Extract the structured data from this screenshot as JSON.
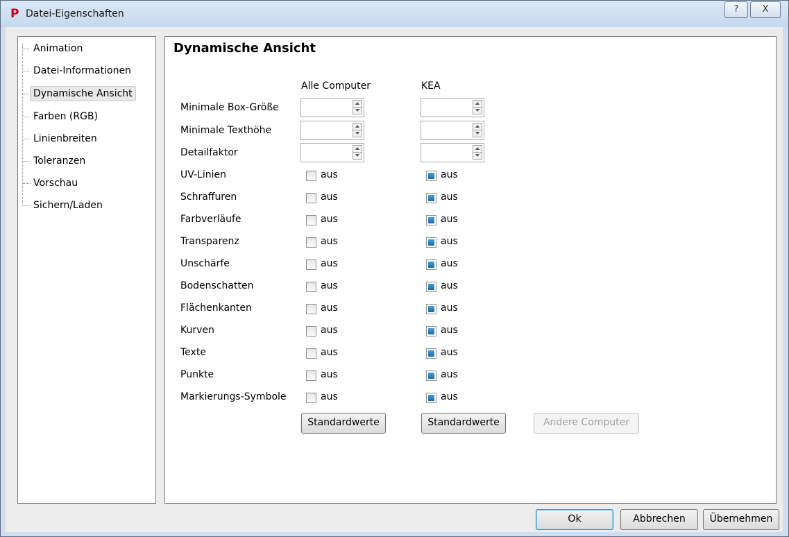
{
  "window": {
    "title": "Datei-Eigenschaften",
    "logo": "P",
    "help": "?",
    "close": "X"
  },
  "tree": {
    "items": [
      {
        "label": "Animation"
      },
      {
        "label": "Datei-Informationen"
      },
      {
        "label": "Dynamische Ansicht",
        "selected": true
      },
      {
        "label": "Farben (RGB)"
      },
      {
        "label": "Linienbreiten"
      },
      {
        "label": "Toleranzen"
      },
      {
        "label": "Vorschau"
      },
      {
        "label": "Sichern/Laden"
      }
    ]
  },
  "panel": {
    "title": "Dynamische Ansicht",
    "col_all": "Alle Computer",
    "col_kea": "KEA",
    "spin_rows": [
      {
        "label": "Minimale Box-Größe",
        "all_value": "",
        "kea_value": ""
      },
      {
        "label": "Minimale Texthöhe",
        "all_value": "",
        "kea_value": ""
      },
      {
        "label": "Detailfaktor",
        "all_value": "",
        "kea_value": ""
      }
    ],
    "check_rows": [
      {
        "label": "UV-Linien",
        "all_text": "aus",
        "kea_text": "aus"
      },
      {
        "label": "Schraffuren",
        "all_text": "aus",
        "kea_text": "aus"
      },
      {
        "label": "Farbverläufe",
        "all_text": "aus",
        "kea_text": "aus"
      },
      {
        "label": "Transparenz",
        "all_text": "aus",
        "kea_text": "aus"
      },
      {
        "label": "Unschärfe",
        "all_text": "aus",
        "kea_text": "aus"
      },
      {
        "label": "Bodenschatten",
        "all_text": "aus",
        "kea_text": "aus"
      },
      {
        "label": "Flächenkanten",
        "all_text": "aus",
        "kea_text": "aus"
      },
      {
        "label": "Kurven",
        "all_text": "aus",
        "kea_text": "aus"
      },
      {
        "label": "Texte",
        "all_text": "aus",
        "kea_text": "aus"
      },
      {
        "label": "Punkte",
        "all_text": "aus",
        "kea_text": "aus"
      },
      {
        "label": "Markierungs-Symbole",
        "all_text": "aus",
        "kea_text": "aus"
      }
    ],
    "btn_std_all": "Standardwerte",
    "btn_std_kea": "Standardwerte",
    "btn_other": "Andere Computer"
  },
  "footer": {
    "ok": "Ok",
    "cancel": "Abbrechen",
    "apply": "Übernehmen"
  }
}
